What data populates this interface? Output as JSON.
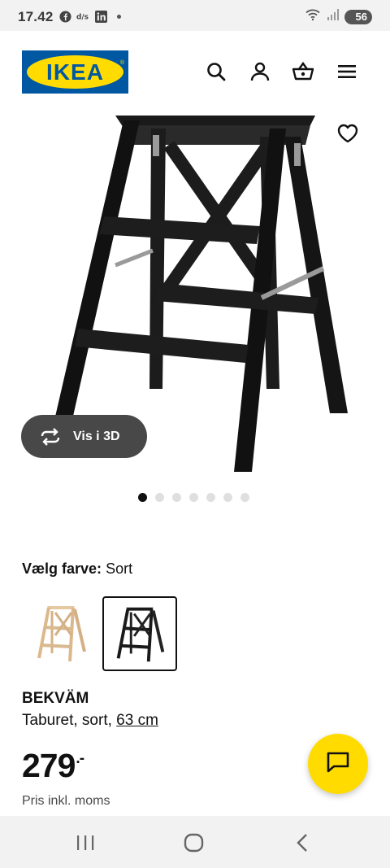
{
  "status_bar": {
    "time": "17.42",
    "battery": "56"
  },
  "header": {
    "logo_text": "IKEA",
    "brand_blue": "#0058a3",
    "brand_yellow": "#ffdb00"
  },
  "hero": {
    "view_3d_label": "Vis i 3D",
    "carousel_count": 7,
    "carousel_active": 1
  },
  "color_select": {
    "label": "Vælg farve:",
    "value": "Sort"
  },
  "product": {
    "name": "BEKVÄM",
    "desc_prefix": "Taburet, sort,",
    "size_link": "63 cm",
    "price_int": "279",
    "price_dec": ".-",
    "price_note": "Pris inkl. moms"
  },
  "icons": {
    "search": "search-icon",
    "account": "user-icon",
    "cart": "basket-icon",
    "menu": "hamburger-menu-icon",
    "favorite": "heart-icon",
    "chat": "chat-icon"
  }
}
